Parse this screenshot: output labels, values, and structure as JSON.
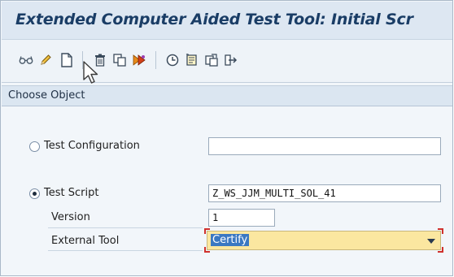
{
  "window": {
    "title": "Extended Computer Aided Test Tool: Initial Scr"
  },
  "toolbar": {
    "icons": [
      "glasses-display-icon",
      "pencil-change-icon",
      "create-document-icon",
      "trash-delete-icon",
      "copy-icon",
      "execute-icon",
      "clock-history-icon",
      "notes-icon",
      "copy-object-icon",
      "transport-arrow-icon"
    ]
  },
  "choose_object": {
    "header": "Choose Object",
    "test_configuration": {
      "label": "Test Configuration",
      "value": "",
      "selected": false
    },
    "test_script": {
      "label": "Test Script",
      "value": "Z_WS_JJM_MULTI_SOL_41",
      "selected": true
    },
    "version": {
      "label": "Version",
      "value": "1"
    },
    "external_tool": {
      "label": "External Tool",
      "value": "Certify"
    }
  },
  "colors": {
    "title_text": "#1a3d66",
    "dropdown_bg": "#fbe7a0",
    "selection_bg": "#3a78c2",
    "focus_red": "#d0312d"
  }
}
